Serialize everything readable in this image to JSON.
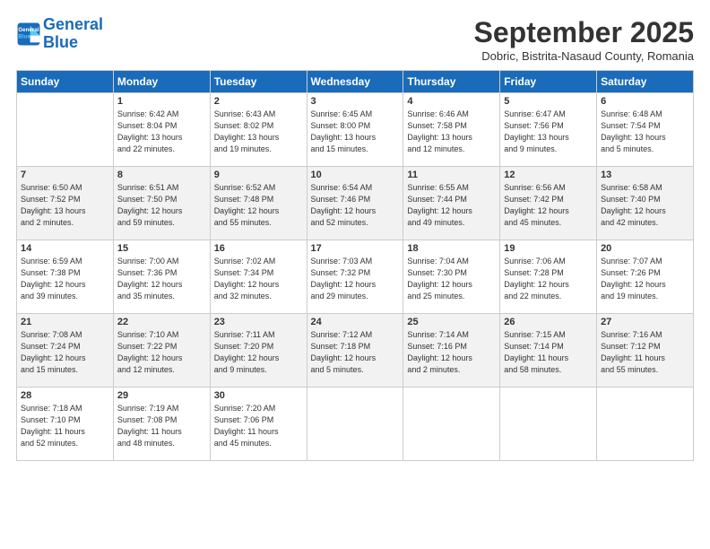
{
  "header": {
    "logo_line1": "General",
    "logo_line2": "Blue",
    "month_title": "September 2025",
    "location": "Dobric, Bistrita-Nasaud County, Romania"
  },
  "days_of_week": [
    "Sunday",
    "Monday",
    "Tuesday",
    "Wednesday",
    "Thursday",
    "Friday",
    "Saturday"
  ],
  "weeks": [
    [
      {
        "day": "",
        "info": ""
      },
      {
        "day": "1",
        "info": "Sunrise: 6:42 AM\nSunset: 8:04 PM\nDaylight: 13 hours\nand 22 minutes."
      },
      {
        "day": "2",
        "info": "Sunrise: 6:43 AM\nSunset: 8:02 PM\nDaylight: 13 hours\nand 19 minutes."
      },
      {
        "day": "3",
        "info": "Sunrise: 6:45 AM\nSunset: 8:00 PM\nDaylight: 13 hours\nand 15 minutes."
      },
      {
        "day": "4",
        "info": "Sunrise: 6:46 AM\nSunset: 7:58 PM\nDaylight: 13 hours\nand 12 minutes."
      },
      {
        "day": "5",
        "info": "Sunrise: 6:47 AM\nSunset: 7:56 PM\nDaylight: 13 hours\nand 9 minutes."
      },
      {
        "day": "6",
        "info": "Sunrise: 6:48 AM\nSunset: 7:54 PM\nDaylight: 13 hours\nand 5 minutes."
      }
    ],
    [
      {
        "day": "7",
        "info": "Sunrise: 6:50 AM\nSunset: 7:52 PM\nDaylight: 13 hours\nand 2 minutes."
      },
      {
        "day": "8",
        "info": "Sunrise: 6:51 AM\nSunset: 7:50 PM\nDaylight: 12 hours\nand 59 minutes."
      },
      {
        "day": "9",
        "info": "Sunrise: 6:52 AM\nSunset: 7:48 PM\nDaylight: 12 hours\nand 55 minutes."
      },
      {
        "day": "10",
        "info": "Sunrise: 6:54 AM\nSunset: 7:46 PM\nDaylight: 12 hours\nand 52 minutes."
      },
      {
        "day": "11",
        "info": "Sunrise: 6:55 AM\nSunset: 7:44 PM\nDaylight: 12 hours\nand 49 minutes."
      },
      {
        "day": "12",
        "info": "Sunrise: 6:56 AM\nSunset: 7:42 PM\nDaylight: 12 hours\nand 45 minutes."
      },
      {
        "day": "13",
        "info": "Sunrise: 6:58 AM\nSunset: 7:40 PM\nDaylight: 12 hours\nand 42 minutes."
      }
    ],
    [
      {
        "day": "14",
        "info": "Sunrise: 6:59 AM\nSunset: 7:38 PM\nDaylight: 12 hours\nand 39 minutes."
      },
      {
        "day": "15",
        "info": "Sunrise: 7:00 AM\nSunset: 7:36 PM\nDaylight: 12 hours\nand 35 minutes."
      },
      {
        "day": "16",
        "info": "Sunrise: 7:02 AM\nSunset: 7:34 PM\nDaylight: 12 hours\nand 32 minutes."
      },
      {
        "day": "17",
        "info": "Sunrise: 7:03 AM\nSunset: 7:32 PM\nDaylight: 12 hours\nand 29 minutes."
      },
      {
        "day": "18",
        "info": "Sunrise: 7:04 AM\nSunset: 7:30 PM\nDaylight: 12 hours\nand 25 minutes."
      },
      {
        "day": "19",
        "info": "Sunrise: 7:06 AM\nSunset: 7:28 PM\nDaylight: 12 hours\nand 22 minutes."
      },
      {
        "day": "20",
        "info": "Sunrise: 7:07 AM\nSunset: 7:26 PM\nDaylight: 12 hours\nand 19 minutes."
      }
    ],
    [
      {
        "day": "21",
        "info": "Sunrise: 7:08 AM\nSunset: 7:24 PM\nDaylight: 12 hours\nand 15 minutes."
      },
      {
        "day": "22",
        "info": "Sunrise: 7:10 AM\nSunset: 7:22 PM\nDaylight: 12 hours\nand 12 minutes."
      },
      {
        "day": "23",
        "info": "Sunrise: 7:11 AM\nSunset: 7:20 PM\nDaylight: 12 hours\nand 9 minutes."
      },
      {
        "day": "24",
        "info": "Sunrise: 7:12 AM\nSunset: 7:18 PM\nDaylight: 12 hours\nand 5 minutes."
      },
      {
        "day": "25",
        "info": "Sunrise: 7:14 AM\nSunset: 7:16 PM\nDaylight: 12 hours\nand 2 minutes."
      },
      {
        "day": "26",
        "info": "Sunrise: 7:15 AM\nSunset: 7:14 PM\nDaylight: 11 hours\nand 58 minutes."
      },
      {
        "day": "27",
        "info": "Sunrise: 7:16 AM\nSunset: 7:12 PM\nDaylight: 11 hours\nand 55 minutes."
      }
    ],
    [
      {
        "day": "28",
        "info": "Sunrise: 7:18 AM\nSunset: 7:10 PM\nDaylight: 11 hours\nand 52 minutes."
      },
      {
        "day": "29",
        "info": "Sunrise: 7:19 AM\nSunset: 7:08 PM\nDaylight: 11 hours\nand 48 minutes."
      },
      {
        "day": "30",
        "info": "Sunrise: 7:20 AM\nSunset: 7:06 PM\nDaylight: 11 hours\nand 45 minutes."
      },
      {
        "day": "",
        "info": ""
      },
      {
        "day": "",
        "info": ""
      },
      {
        "day": "",
        "info": ""
      },
      {
        "day": "",
        "info": ""
      }
    ]
  ]
}
